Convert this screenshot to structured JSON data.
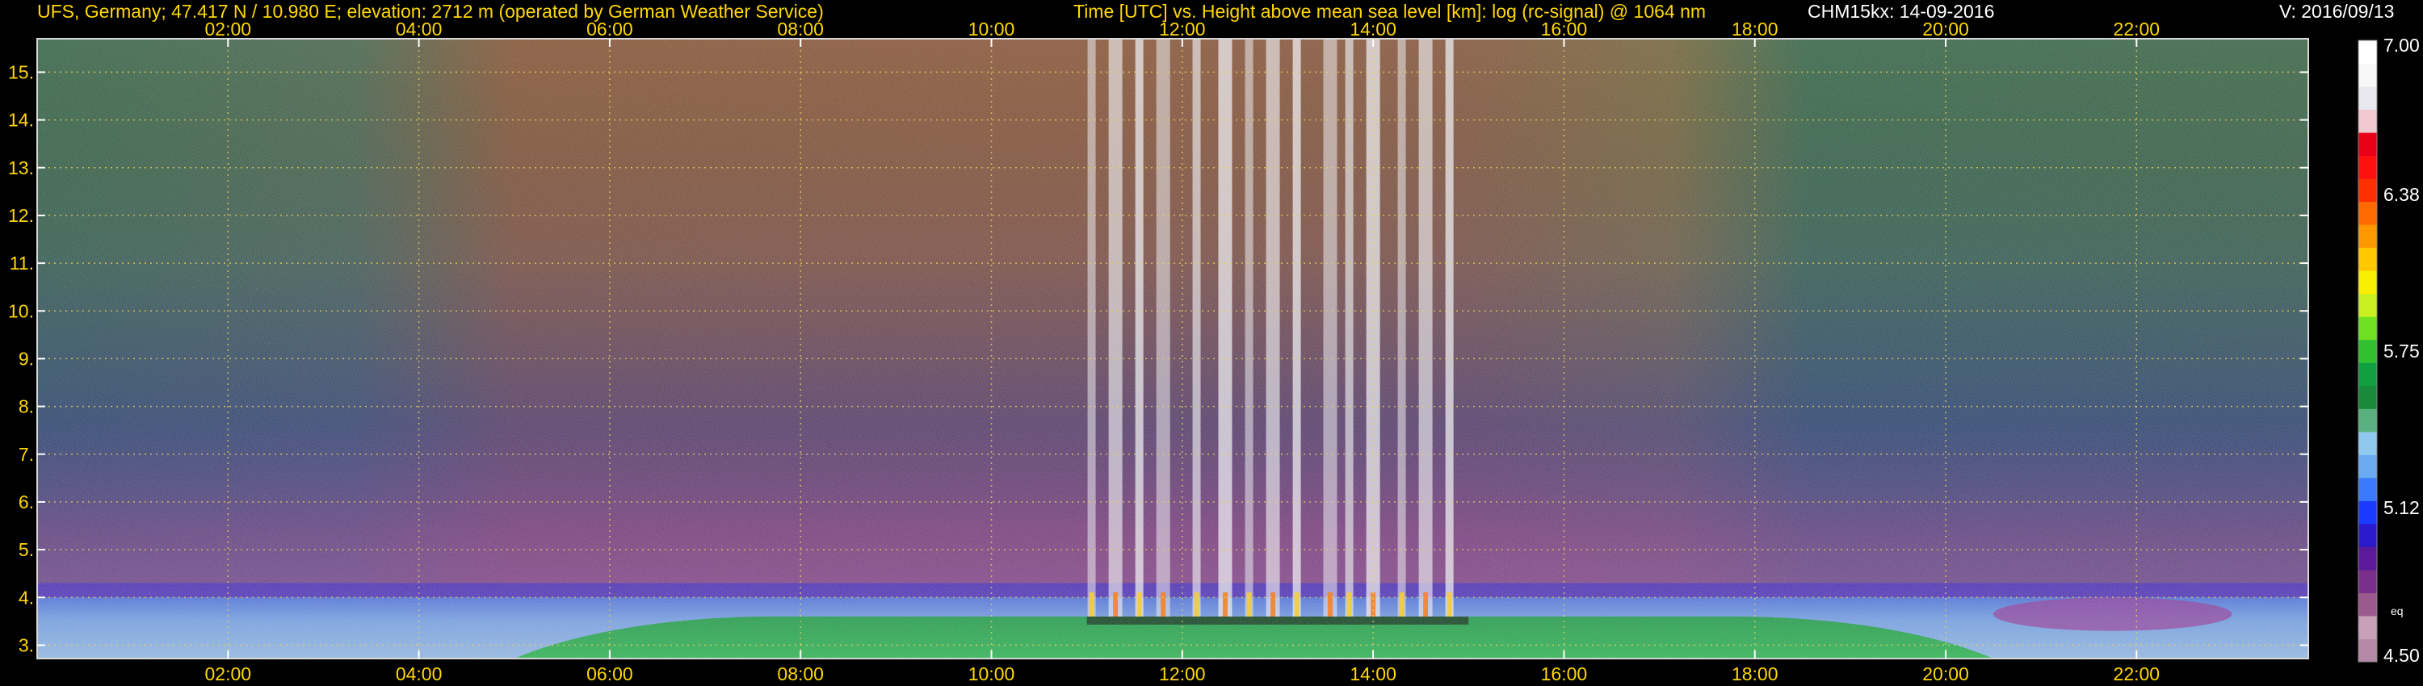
{
  "header": {
    "station": "UFS, Germany; 47.417 N / 10.980 E; elevation: 2712 m  (operated by German Weather Service)",
    "axes_title": "Time [UTC] vs. Height above mean sea level [km]: log (rc-signal) @ 1064 nm",
    "instrument_date": "CHM15kx: 14-09-2016",
    "version": "V: 2016/09/13"
  },
  "chart_data": {
    "type": "heatmap",
    "title": "Time [UTC] vs. Height above mean sea level [km]: log (rc-signal) @ 1064 nm",
    "xlabel": "Time [UTC]",
    "ylabel": "Height above mean sea level [km]",
    "x_ticks": [
      "02:00",
      "04:00",
      "06:00",
      "08:00",
      "10:00",
      "12:00",
      "14:00",
      "16:00",
      "18:00",
      "20:00",
      "22:00"
    ],
    "x_tick_hours": [
      2,
      4,
      6,
      8,
      10,
      12,
      14,
      16,
      18,
      20,
      22
    ],
    "xlim_hours": [
      0.0,
      23.8
    ],
    "y_ticks": [
      "3.",
      "4.",
      "5.",
      "6.",
      "7.",
      "8.",
      "9.",
      "10.",
      "11.",
      "12.",
      "13.",
      "14.",
      "15."
    ],
    "y_tick_values": [
      3,
      4,
      5,
      6,
      7,
      8,
      9,
      10,
      11,
      12,
      13,
      14,
      15
    ],
    "ylim_km": [
      2.72,
      15.7
    ],
    "grid": true,
    "colorbar": {
      "ticks": [
        "7.00",
        "6.38",
        "5.75",
        "5.12",
        "4.50"
      ],
      "tick_values": [
        7.0,
        6.38,
        5.75,
        5.12,
        4.5
      ],
      "range": [
        4.5,
        7.0
      ],
      "annotation": "eq",
      "colors": [
        "#b58aa6",
        "#c8a0b8",
        "#9b5a8e",
        "#7a2f8c",
        "#5a1a9a",
        "#2a1acc",
        "#1a3aff",
        "#3a7aff",
        "#6aaaf0",
        "#90c8ee",
        "#5ab080",
        "#1a8a3a",
        "#10a040",
        "#30c030",
        "#70e020",
        "#c8f020",
        "#f8f000",
        "#ffc800",
        "#ff9800",
        "#ff6a00",
        "#ff3000",
        "#ff1010",
        "#e80018",
        "#f0c8d0",
        "#e8e8ee",
        "#f8f8f8",
        "#ffffff"
      ]
    },
    "regions": [
      {
        "name": "surface aerosol layer",
        "x_hours": [
          0,
          23.8
        ],
        "y_km": [
          2.72,
          4.3
        ]
      },
      {
        "name": "residual layer top (violet)",
        "x_hours": [
          0,
          23.8
        ],
        "y_km": [
          4.0,
          4.3
        ]
      },
      {
        "name": "daytime boundary layer (green)",
        "x_hours": [
          5.0,
          20.5
        ],
        "y_km": [
          2.72,
          3.6
        ]
      },
      {
        "name": "convective cloud plumes (white)",
        "x_hours": [
          11.0,
          15.0
        ],
        "y_km": [
          3.6,
          15.7
        ]
      },
      {
        "name": "nocturnal enhanced layer (magenta)",
        "x_hours": [
          20.5,
          23.0
        ],
        "y_km": [
          3.3,
          4.0
        ]
      }
    ]
  }
}
